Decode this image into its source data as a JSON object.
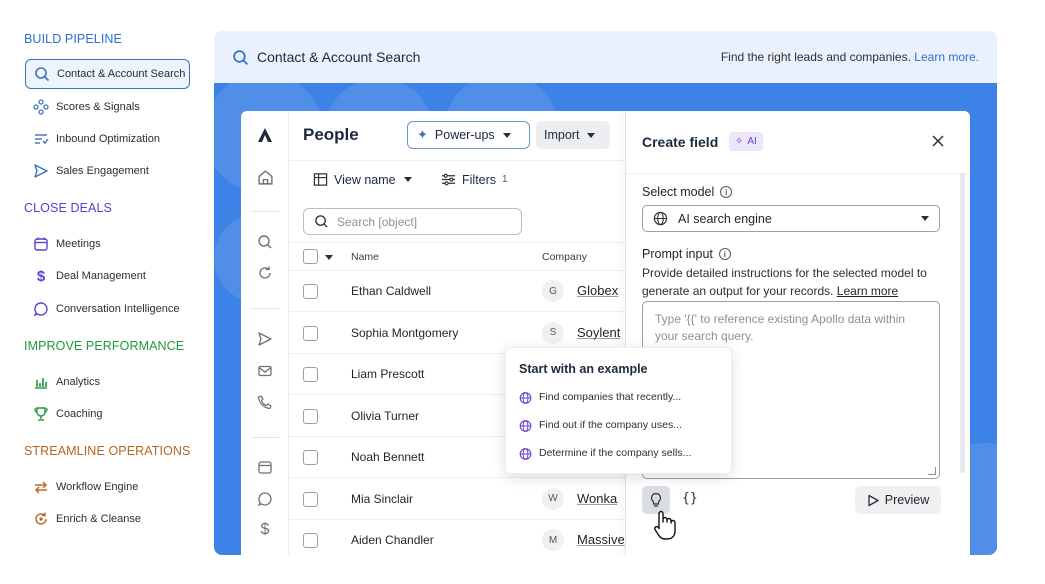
{
  "sidebar": {
    "sections": [
      {
        "title": "BUILD PIPELINE",
        "color": "#2d6fd1",
        "items": [
          {
            "label": "Contact & Account Search",
            "icon": "search-icon",
            "active": true
          },
          {
            "label": "Scores & Signals",
            "icon": "signals-icon"
          },
          {
            "label": "Inbound Optimization",
            "icon": "inbound-icon"
          },
          {
            "label": "Sales Engagement",
            "icon": "send-icon"
          }
        ]
      },
      {
        "title": "CLOSE DEALS",
        "color": "#5a3fd6",
        "items": [
          {
            "label": "Meetings",
            "icon": "calendar-icon"
          },
          {
            "label": "Deal Management",
            "icon": "dollar-icon"
          },
          {
            "label": "Conversation Intelligence",
            "icon": "chat-icon"
          }
        ]
      },
      {
        "title": "IMPROVE PERFORMANCE",
        "color": "#1e9a3b",
        "items": [
          {
            "label": "Analytics",
            "icon": "bar-chart-icon"
          },
          {
            "label": "Coaching",
            "icon": "trophy-icon"
          }
        ]
      },
      {
        "title": "STREAMLINE OPERATIONS",
        "color": "#b8641f",
        "items": [
          {
            "label": "Workflow Engine",
            "icon": "swap-arrows-icon"
          },
          {
            "label": "Enrich & Cleanse",
            "icon": "refresh-icon"
          }
        ]
      }
    ]
  },
  "header": {
    "title": "Contact & Account Search",
    "hint": "Find the right leads and companies.",
    "hint_link": "Learn more."
  },
  "people": {
    "title": "People",
    "powerups_label": "Power-ups",
    "import_label": "Import",
    "view_name_label": "View name",
    "filters_label": "Filters",
    "filters_count": "1",
    "search_placeholder": "Search [object]",
    "columns": {
      "name": "Name",
      "company": "Company"
    },
    "rows": [
      {
        "name": "Ethan Caldwell",
        "initial": "G",
        "company": "Globex"
      },
      {
        "name": "Sophia Montgomery",
        "initial": "S",
        "company": "Soylent"
      },
      {
        "name": "Liam Prescott",
        "initial": "",
        "company": ""
      },
      {
        "name": "Olivia Turner",
        "initial": "",
        "company": ""
      },
      {
        "name": "Noah Bennett",
        "initial": "",
        "company": ""
      },
      {
        "name": "Mia Sinclair",
        "initial": "W",
        "company": "Wonka"
      },
      {
        "name": "Aiden Chandler",
        "initial": "M",
        "company": "Massive"
      }
    ]
  },
  "panel": {
    "title": "Create field",
    "ai_badge": "AI",
    "select_model_label": "Select model",
    "model_value": "AI search engine",
    "prompt_label": "Prompt input",
    "prompt_desc": "Provide detailed instructions for the selected model to generate an output for your records.",
    "prompt_desc_link": "Learn more",
    "prompt_placeholder": "Type '{{' to reference existing Apollo data within your search query.",
    "braces": "{}",
    "preview_label": "Preview"
  },
  "popover": {
    "title": "Start with an example",
    "examples": [
      "Find companies that recently...",
      "Find out if the company uses...",
      "Determine if the company sells..."
    ]
  },
  "colors": {
    "accent_blue": "#3d82e6",
    "ai_purple": "#6a3fd1"
  }
}
